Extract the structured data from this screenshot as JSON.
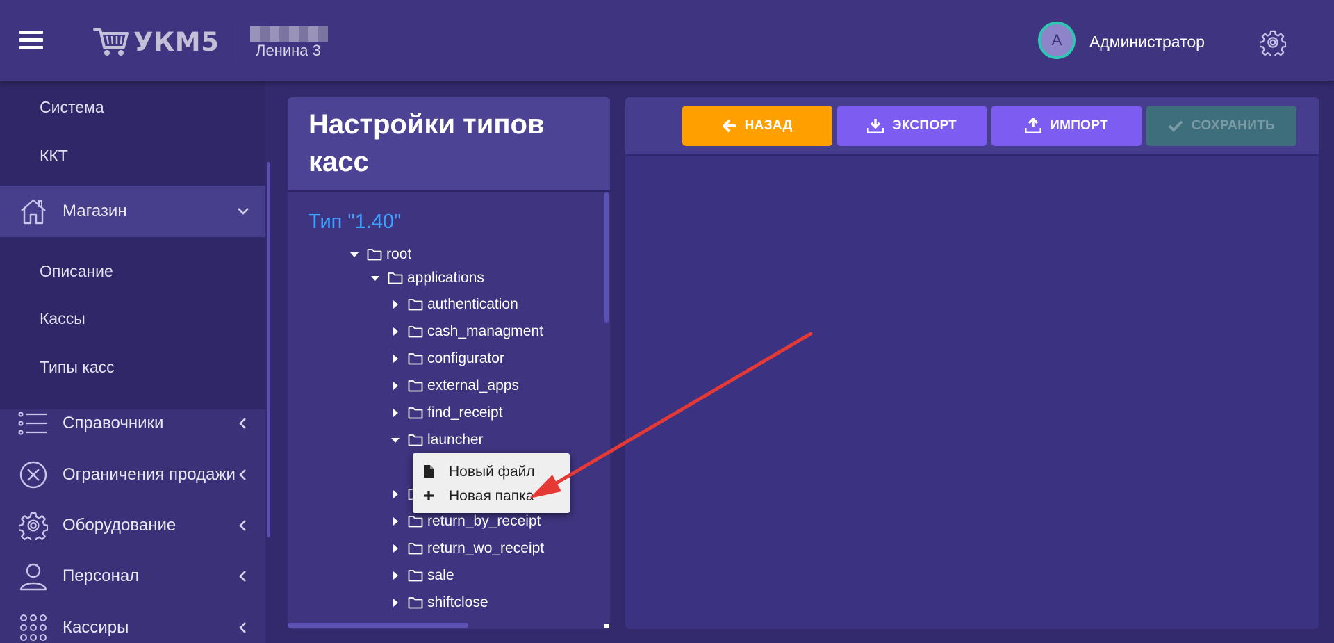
{
  "header": {
    "menu_icon": "hamburger-icon",
    "logo_icon": "cart-icon",
    "logo_text": "УКМ5",
    "store_name": "Ленина 3",
    "avatar_letter": "А",
    "username": "Администратор",
    "settings_icon": "gear-icon"
  },
  "sidebar": {
    "top_sub_items": [
      {
        "label": "Система"
      },
      {
        "label": "ККТ"
      }
    ],
    "store_section": {
      "label": "Магазин",
      "icon": "house-icon"
    },
    "store_sub_items": [
      {
        "label": "Описание"
      },
      {
        "label": "Кассы"
      },
      {
        "label": "Типы касс"
      }
    ],
    "sections": [
      {
        "label": "Справочники",
        "icon": "list-icon"
      },
      {
        "label": "Ограничения продажи",
        "icon": "cancel-circle-icon"
      },
      {
        "label": "Оборудование",
        "icon": "gear-icon"
      },
      {
        "label": "Персонал",
        "icon": "user-icon"
      },
      {
        "label": "Кассиры",
        "icon": "grid-dots-icon"
      }
    ]
  },
  "tree_panel": {
    "title": "Настройки типов касс",
    "type_label": "Тип \"1.40\"",
    "nodes": [
      {
        "label": "root",
        "expanded": true
      },
      {
        "label": "applications",
        "expanded": true
      },
      {
        "label": "authentication",
        "expanded": false
      },
      {
        "label": "cash_managment",
        "expanded": false
      },
      {
        "label": "configurator",
        "expanded": false
      },
      {
        "label": "external_apps",
        "expanded": false
      },
      {
        "label": "find_receipt",
        "expanded": false
      },
      {
        "label": "launcher",
        "expanded": true
      },
      {
        "label": "",
        "expanded": false
      },
      {
        "label": "return_by_receipt",
        "expanded": false
      },
      {
        "label": "return_wo_receipt",
        "expanded": false
      },
      {
        "label": "sale",
        "expanded": false
      },
      {
        "label": "shiftclose",
        "expanded": false
      }
    ]
  },
  "context_menu": {
    "items": [
      {
        "label": "Новый файл",
        "icon": "file-icon"
      },
      {
        "label": "Новая папка",
        "icon": "plus-icon"
      }
    ]
  },
  "toolbar": {
    "back_label": "НАЗАД",
    "export_label": "ЭКСПОРТ",
    "import_label": "ИМПОРТ",
    "save_label": "СОХРАНИТЬ",
    "save_enabled": false
  },
  "colors": {
    "header_bg": "#3e347f",
    "sidebar_bg": "#3a3179",
    "accent_link": "#3ea0ff",
    "back_button": "#ffa000",
    "action_button": "#7d5cf2",
    "save_disabled": "#3e6e7c",
    "avatar_ring": "#2ec7b3",
    "annotation_arrow": "#e53935"
  }
}
